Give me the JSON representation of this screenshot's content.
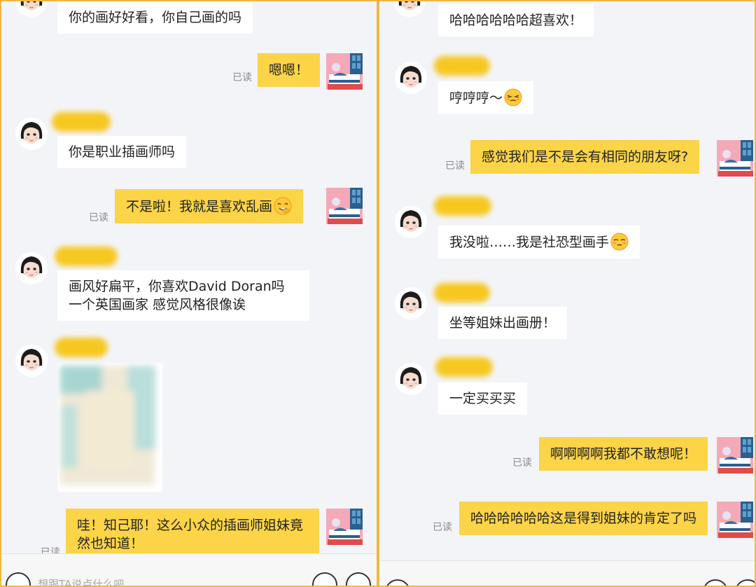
{
  "colors": {
    "frame": "#f2b740",
    "outgoing_bubble": "#fbd447",
    "incoming_bubble": "#ffffff",
    "background": "#f3f4f8"
  },
  "left": {
    "messages": {
      "m1": "你的画好好看，你自己画的吗",
      "m2": "嗯嗯！",
      "m3": "你是职业插画师吗",
      "m4": "不是啦！我就是喜欢乱画",
      "m5": "画风好扁平，你喜欢David Doran吗 一个英国画家 感觉风格很像诶",
      "m6": "哇！知己耶！这么小众的插画师姐妹竟然也知道！"
    },
    "read": "已读",
    "input_hint": "想跟TA说点什么吧",
    "icons": {
      "voice": "voice-icon",
      "emoji": "emoji-icon",
      "plus": "plus-icon",
      "emoji_in_message": "covering-mouth-laugh-emoji"
    }
  },
  "right": {
    "messages": {
      "m1": "哈哈哈哈哈哈超喜欢！",
      "m2": "哼哼哼～",
      "m3": "感觉我们是不是会有相同的朋友呀?",
      "m4": "我没啦……我是社恐型画手",
      "m5": "坐等姐妹出画册！",
      "m6": "一定买买买",
      "m7": "啊啊啊啊我都不敢想呢！",
      "m8": "哈哈哈哈哈哈这是得到姐妹的肯定了吗"
    },
    "read": "已读",
    "icons": {
      "smug_emoji": "smug-face-emoji",
      "shy_emoji": "shy-face-emoji"
    }
  }
}
